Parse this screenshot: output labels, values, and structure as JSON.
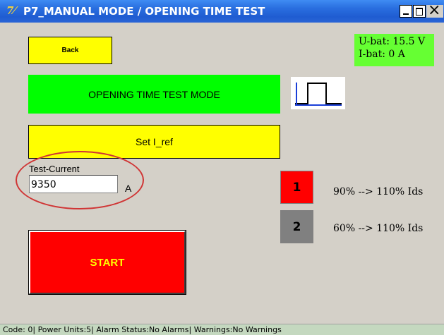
{
  "window": {
    "icon_glyph": "7⁄",
    "title": "P7_MANUAL MODE / OPENING TIME TEST",
    "controls": [
      "minimize-icon",
      "maximize-icon",
      "close-icon"
    ]
  },
  "back_button": {
    "label": "Back"
  },
  "battery": {
    "voltage": "U-bat: 15.5 V",
    "current": "I-bat: 0 A"
  },
  "mode_banner": {
    "label": "OPENING TIME TEST MODE"
  },
  "pulse_icon": {
    "name": "pulse-waveform-icon"
  },
  "set_ref_button": {
    "label": "Set I_ref"
  },
  "test_current": {
    "label": "Test-Current",
    "value": "9350",
    "unit": "A"
  },
  "ranges": [
    {
      "number": "1",
      "text": "90% --> 110% Ids",
      "color": "#ff0000"
    },
    {
      "number": "2",
      "text": "60% --> 110% Ids",
      "color": "#808080"
    }
  ],
  "start_button": {
    "label": "START"
  },
  "status_bar": {
    "text": "Code: 0| Power Units:5| Alarm Status:No Alarms| Warnings:No Warnings"
  },
  "colors": {
    "title_bar": "#1f5cd1",
    "green": "#00ff00",
    "yellow": "#ffff00",
    "red": "#ff0000",
    "background": "#d4d0c8"
  }
}
